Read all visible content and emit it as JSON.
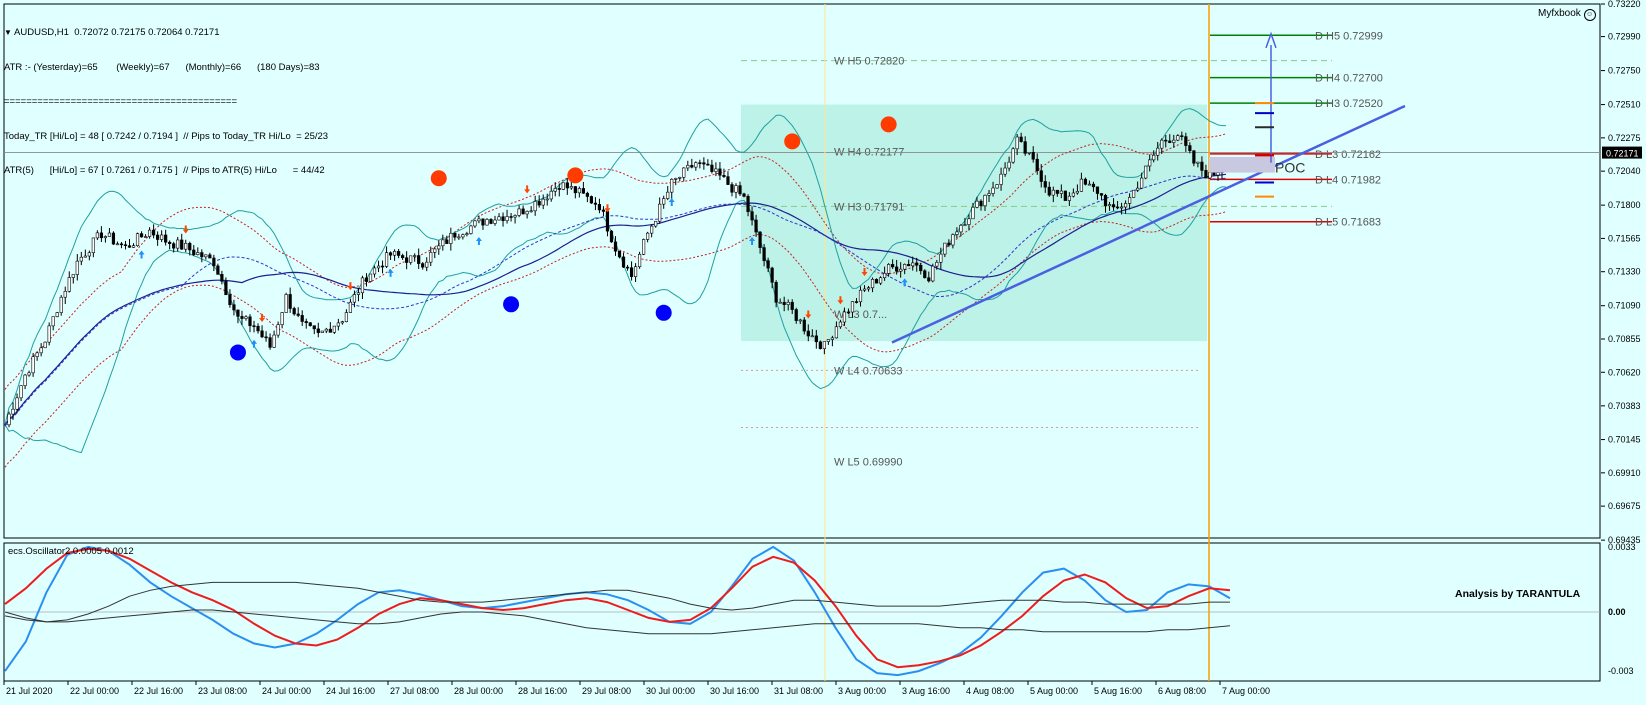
{
  "header": {
    "symbol_line": "AUDUSD,H1  0.72072 0.72175 0.72064 0.72171",
    "atr_line": "ATR :- (Yesterday)=65       (Weekly)=67      (Monthly)=66      (180 Days)=83",
    "separator": "==========================================",
    "today_line": "Today_TR [Hi/Lo] = 48 [ 0.7242 / 0.7194 ]  // Pips to Today_TR Hi/Lo  = 25/23",
    "atr5_line": "ATR(5)      [Hi/Lo] = 67 [ 0.7261 / 0.7175 ]  // Pips to ATR(5) Hi/Lo      = 44/42",
    "brand": "Myfxbook"
  },
  "indicator": {
    "title": "ecs.Oscillator2 0.0005 0.0012",
    "watermark": "Analysis by TARANTULA",
    "poc_label": "POC"
  },
  "colors": {
    "background": "#e0ffff",
    "bull_candle": "#ffffff",
    "bear_candle": "#000000",
    "bollinger": "#20a0a0",
    "ma": "#1e1e90",
    "envelope": "#cc2020",
    "trendline": "#4a60e0",
    "box_fill": "#b0eee0",
    "osc_blue": "#2b8ff0",
    "osc_red": "#ee1c1c",
    "osc_dark": "#333333",
    "session_line": "#f5a000",
    "highlight_bid": "#000000"
  },
  "chart_data": [
    {
      "type": "candlestick",
      "title": "AUDUSD,H1",
      "current_price": "0.72171",
      "ylim": [
        0.6945,
        0.7322
      ],
      "y_ticks": [
        "0.73220",
        "0.72990",
        "0.72750",
        "0.72510",
        "0.72275",
        "0.72040",
        "0.71800",
        "0.71565",
        "0.71330",
        "0.71090",
        "0.70855",
        "0.70620",
        "0.70383",
        "0.70145",
        "0.69910",
        "0.69675",
        "0.69435"
      ],
      "x_ticks": [
        "21 Jul 2020",
        "22 Jul 00:00",
        "22 Jul 16:00",
        "23 Jul 08:00",
        "24 Jul 00:00",
        "24 Jul 16:00",
        "27 Jul 08:00",
        "28 Jul 00:00",
        "28 Jul 16:00",
        "29 Jul 08:00",
        "30 Jul 00:00",
        "30 Jul 16:00",
        "31 Jul 08:00",
        "3 Aug 00:00",
        "3 Aug 16:00",
        "4 Aug 08:00",
        "5 Aug 00:00",
        "5 Aug 16:00",
        "6 Aug 08:00",
        "7 Aug 00:00"
      ],
      "close_path": [
        [
          0,
          0.7025
        ],
        [
          5,
          0.706
        ],
        [
          10,
          0.7085
        ],
        [
          14,
          0.7115
        ],
        [
          18,
          0.714
        ],
        [
          24,
          0.716
        ],
        [
          30,
          0.715
        ],
        [
          36,
          0.7162
        ],
        [
          40,
          0.7155
        ],
        [
          45,
          0.715
        ],
        [
          52,
          0.714
        ],
        [
          58,
          0.71
        ],
        [
          62,
          0.7095
        ],
        [
          66,
          0.708
        ],
        [
          70,
          0.7115
        ],
        [
          74,
          0.7095
        ],
        [
          78,
          0.7088
        ],
        [
          84,
          0.71
        ],
        [
          90,
          0.713
        ],
        [
          96,
          0.7145
        ],
        [
          104,
          0.714
        ],
        [
          112,
          0.716
        ],
        [
          120,
          0.717
        ],
        [
          128,
          0.7175
        ],
        [
          134,
          0.7185
        ],
        [
          138,
          0.7195
        ],
        [
          142,
          0.719
        ],
        [
          148,
          0.718
        ],
        [
          152,
          0.715
        ],
        [
          156,
          0.713
        ],
        [
          160,
          0.716
        ],
        [
          166,
          0.7195
        ],
        [
          172,
          0.721
        ],
        [
          178,
          0.72
        ],
        [
          184,
          0.7185
        ],
        [
          188,
          0.715
        ],
        [
          192,
          0.7115
        ],
        [
          196,
          0.7105
        ],
        [
          200,
          0.709
        ],
        [
          204,
          0.708
        ],
        [
          208,
          0.71
        ],
        [
          214,
          0.712
        ],
        [
          220,
          0.7135
        ],
        [
          226,
          0.714
        ],
        [
          230,
          0.713
        ],
        [
          236,
          0.716
        ],
        [
          242,
          0.718
        ],
        [
          248,
          0.72
        ],
        [
          252,
          0.7225
        ],
        [
          256,
          0.721
        ],
        [
          260,
          0.719
        ],
        [
          264,
          0.7185
        ],
        [
          268,
          0.7195
        ],
        [
          272,
          0.719
        ],
        [
          276,
          0.7175
        ],
        [
          280,
          0.7185
        ],
        [
          284,
          0.7205
        ],
        [
          288,
          0.7225
        ],
        [
          292,
          0.723
        ],
        [
          296,
          0.721
        ],
        [
          300,
          0.72
        ],
        [
          304,
          0.721
        ]
      ],
      "pivots": [
        {
          "label": "D  H5 0.72999",
          "value": 0.72999,
          "color": "#008000"
        },
        {
          "label": "D  H4 0.72700",
          "value": 0.727,
          "color": "#008000"
        },
        {
          "label": "D  H3 0.72520",
          "value": 0.7252,
          "color": "#008000"
        },
        {
          "label": "D  L3 0.72162",
          "value": 0.72162,
          "color": "#e00000"
        },
        {
          "label": "D  L4 0.71982",
          "value": 0.71982,
          "color": "#e00000"
        },
        {
          "label": "D  L5 0.71683",
          "value": 0.71683,
          "color": "#e00000"
        },
        {
          "label": "W  H5 0.72820",
          "value": 0.7282,
          "color": "#90d090"
        },
        {
          "label": "W  H4 0.72177",
          "value": 0.72177,
          "color": "#90d090"
        },
        {
          "label": "W  H3 0.71791",
          "value": 0.71791,
          "color": "#90d090"
        },
        {
          "label": "W  L3 0.7...",
          "value": 0.7103,
          "color": "#d09090"
        },
        {
          "label": "W  L4 0.70633",
          "value": 0.70633,
          "color": "#d09090"
        },
        {
          "label": "W  L5 0.69990",
          "value": 0.6999,
          "color": "#d09090"
        }
      ],
      "signal_dots": [
        {
          "bar": 58,
          "price": 0.7076,
          "color": "#0000ff"
        },
        {
          "bar": 108,
          "price": 0.7199,
          "color": "#ff3b00"
        },
        {
          "bar": 126,
          "price": 0.711,
          "color": "#0000ff"
        },
        {
          "bar": 142,
          "price": 0.7201,
          "color": "#ff3b00"
        },
        {
          "bar": 164,
          "price": 0.7104,
          "color": "#0000ff"
        },
        {
          "bar": 196,
          "price": 0.7225,
          "color": "#ff3b00"
        },
        {
          "bar": 220,
          "price": 0.7237,
          "color": "#ff3b00"
        }
      ]
    },
    {
      "type": "line",
      "title": "ecs.Oscillator2 0.0005 0.0012",
      "ylim": [
        -0.0035,
        0.0035
      ],
      "y_ticks": [
        "0.0033",
        "0.00",
        "-0.003"
      ],
      "series": [
        {
          "color": "blue",
          "values": [
            -0.003,
            -0.0015,
            0.001,
            0.0029,
            0.0033,
            0.0031,
            0.0024,
            0.0015,
            0.0008,
            0.0002,
            -0.0004,
            -0.0011,
            -0.0016,
            -0.0018,
            -0.0016,
            -0.0011,
            -0.0004,
            0.0004,
            0.001,
            0.0011,
            0.0009,
            0.0006,
            0.0003,
            0.0002,
            0.0003,
            0.0005,
            0.0007,
            0.0009,
            0.001,
            0.0009,
            0.0006,
            0.0001,
            -0.0005,
            -0.0006,
            0.0,
            0.0013,
            0.0027,
            0.0033,
            0.0026,
            0.001,
            -0.0008,
            -0.0024,
            -0.0031,
            -0.0032,
            -0.003,
            -0.0026,
            -0.0021,
            -0.0013,
            -0.0002,
            0.001,
            0.002,
            0.0022,
            0.0016,
            0.0006,
            0.0,
            0.0001,
            0.001,
            0.0014,
            0.0013,
            0.0007
          ]
        },
        {
          "color": "red",
          "values": [
            0.0004,
            0.0012,
            0.0022,
            0.003,
            0.0032,
            0.0031,
            0.0027,
            0.0021,
            0.0015,
            0.001,
            0.0006,
            0.0001,
            -0.0006,
            -0.0012,
            -0.0016,
            -0.0017,
            -0.0014,
            -0.0008,
            -0.0001,
            0.0004,
            0.0007,
            0.0006,
            0.0004,
            0.0002,
            0.0001,
            0.0002,
            0.0004,
            0.0006,
            0.0007,
            0.0005,
            0.0001,
            -0.0003,
            -0.0005,
            -0.0004,
            0.0002,
            0.0012,
            0.0023,
            0.0028,
            0.0025,
            0.0016,
            0.0003,
            -0.0012,
            -0.0024,
            -0.0028,
            -0.0027,
            -0.0025,
            -0.0022,
            -0.0017,
            -0.001,
            -0.0002,
            0.0008,
            0.0016,
            0.0019,
            0.0015,
            0.0007,
            0.0002,
            0.0003,
            0.0008,
            0.0012,
            0.0011
          ]
        },
        {
          "color": "dark",
          "values": [
            0.0,
            -0.0003,
            -0.0005,
            -0.0004,
            -0.0001,
            0.0003,
            0.0008,
            0.0011,
            0.0013,
            0.0014,
            0.0015,
            0.0015,
            0.0015,
            0.0015,
            0.0015,
            0.0014,
            0.0013,
            0.0012,
            0.001,
            0.0008,
            0.0006,
            0.0005,
            0.0005,
            0.0005,
            0.0006,
            0.0007,
            0.0008,
            0.0009,
            0.001,
            0.0011,
            0.0011,
            0.0009,
            0.0007,
            0.0004,
            0.0002,
            0.0001,
            0.0002,
            0.0004,
            0.0006,
            0.0006,
            0.0005,
            0.0004,
            0.0003,
            0.0003,
            0.0003,
            0.0003,
            0.0004,
            0.0005,
            0.0006,
            0.0006,
            0.0006,
            0.0005,
            0.0005,
            0.0004,
            0.0004,
            0.0004,
            0.0004,
            0.0004,
            0.0005,
            0.0005
          ]
        },
        {
          "color": "dark2",
          "values": [
            -0.0002,
            -0.0004,
            -0.0005,
            -0.0005,
            -0.0004,
            -0.0003,
            -0.0002,
            -0.0001,
            0.0,
            0.0001,
            0.0001,
            0.0,
            -0.0001,
            -0.0002,
            -0.0003,
            -0.0004,
            -0.0005,
            -0.0006,
            -0.0006,
            -0.0005,
            -0.0003,
            -0.0001,
            0.0,
            0.0,
            -0.0001,
            -0.0002,
            -0.0004,
            -0.0006,
            -0.0008,
            -0.0009,
            -0.001,
            -0.0011,
            -0.0011,
            -0.0011,
            -0.0011,
            -0.001,
            -0.0009,
            -0.0008,
            -0.0007,
            -0.0006,
            -0.0006,
            -0.0006,
            -0.0006,
            -0.0006,
            -0.0006,
            -0.0007,
            -0.0008,
            -0.0008,
            -0.0009,
            -0.0009,
            -0.001,
            -0.001,
            -0.001,
            -0.001,
            -0.001,
            -0.001,
            -0.0009,
            -0.0009,
            -0.0008,
            -0.0007
          ]
        }
      ]
    }
  ]
}
